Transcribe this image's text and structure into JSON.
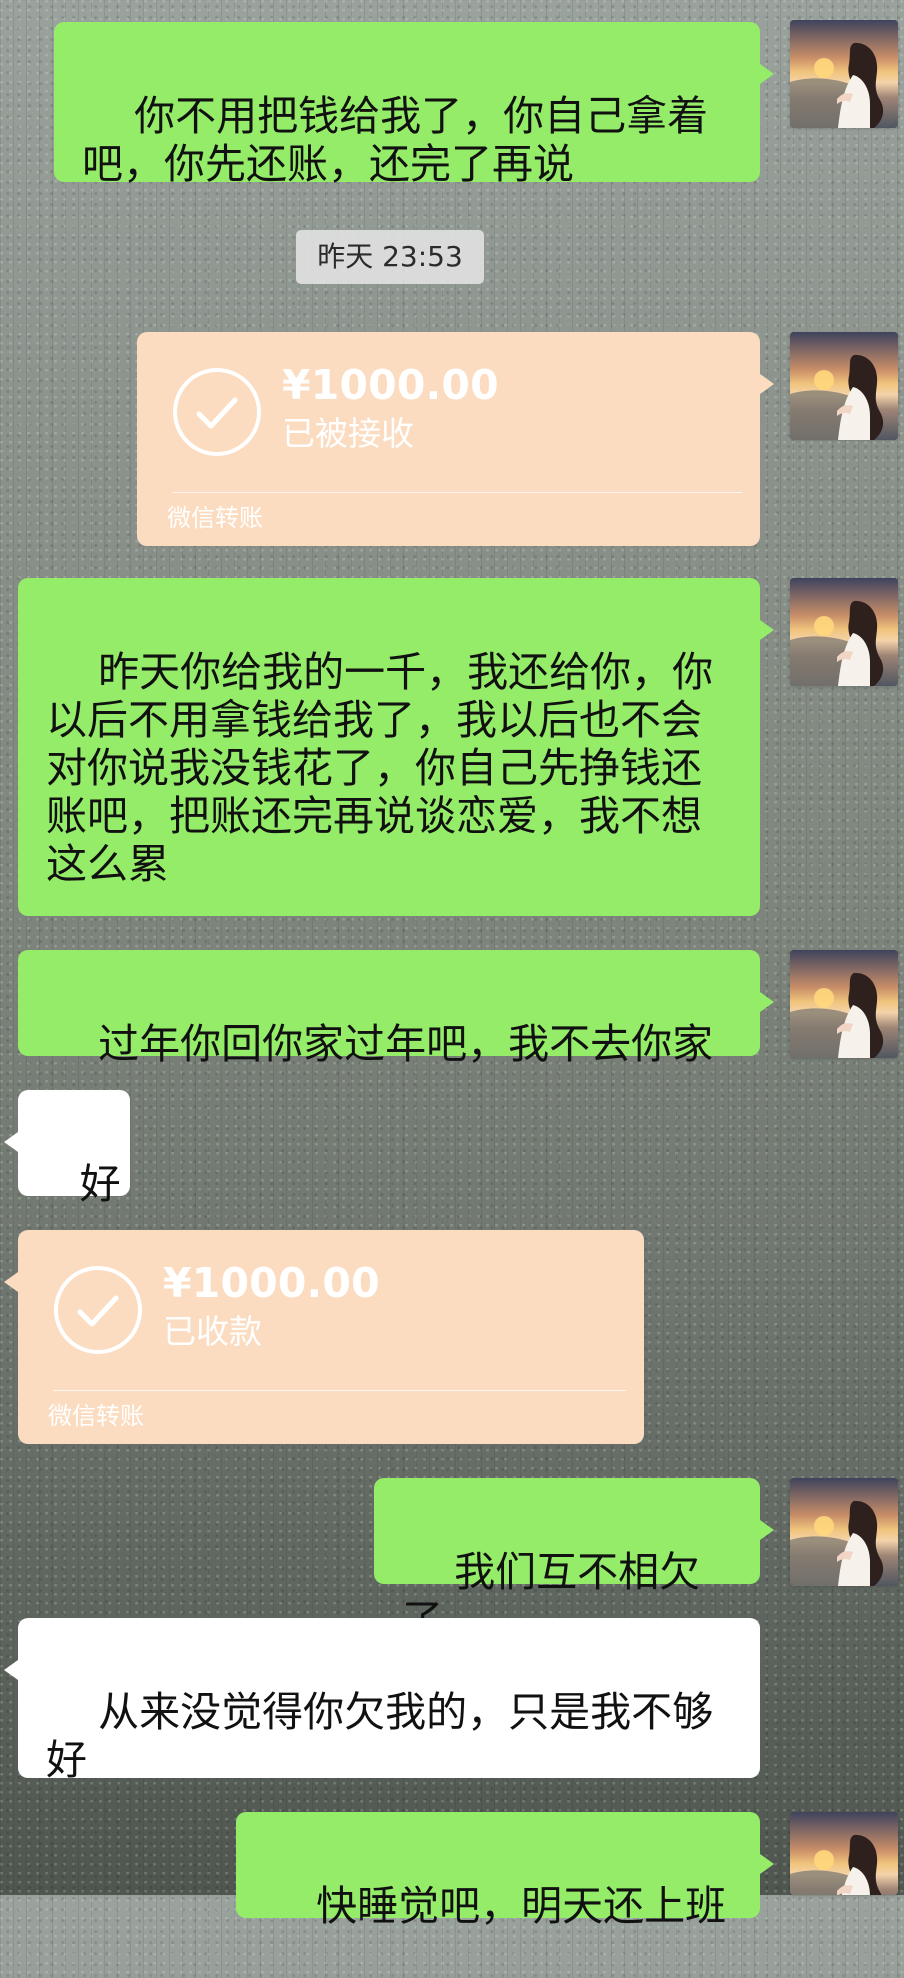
{
  "messages": {
    "m1": "你不用把钱给我了，你自己拿着吧，你先还账，还完了再说",
    "time_badge": "昨天 23:53",
    "transfer_right": {
      "amount": "¥1000.00",
      "status": "已被接收",
      "label": "微信转账"
    },
    "m2": "昨天你给我的一千，我还给你，你以后不用拿钱给我了，我以后也不会对你说我没钱花了，你自己先挣钱还账吧，把账还完再说谈恋爱，我不想这么累",
    "m3": "过年你回你家过年吧，我不去你家",
    "m4": "好",
    "transfer_left": {
      "amount": "¥1000.00",
      "status": "已收款",
      "label": "微信转账"
    },
    "m5": "我们互不相欠了",
    "m6": "从来没觉得你欠我的，只是我不够好",
    "m7": "快睡觉吧，明天还上班"
  },
  "icons": {
    "avatar": "avatar-icon",
    "check": "check-circle-icon"
  },
  "colors": {
    "green_bubble": "#95ec69",
    "white_bubble": "#ffffff",
    "transfer_bg": "#fbdcc0",
    "time_badge_bg": "#e1e1e1"
  }
}
